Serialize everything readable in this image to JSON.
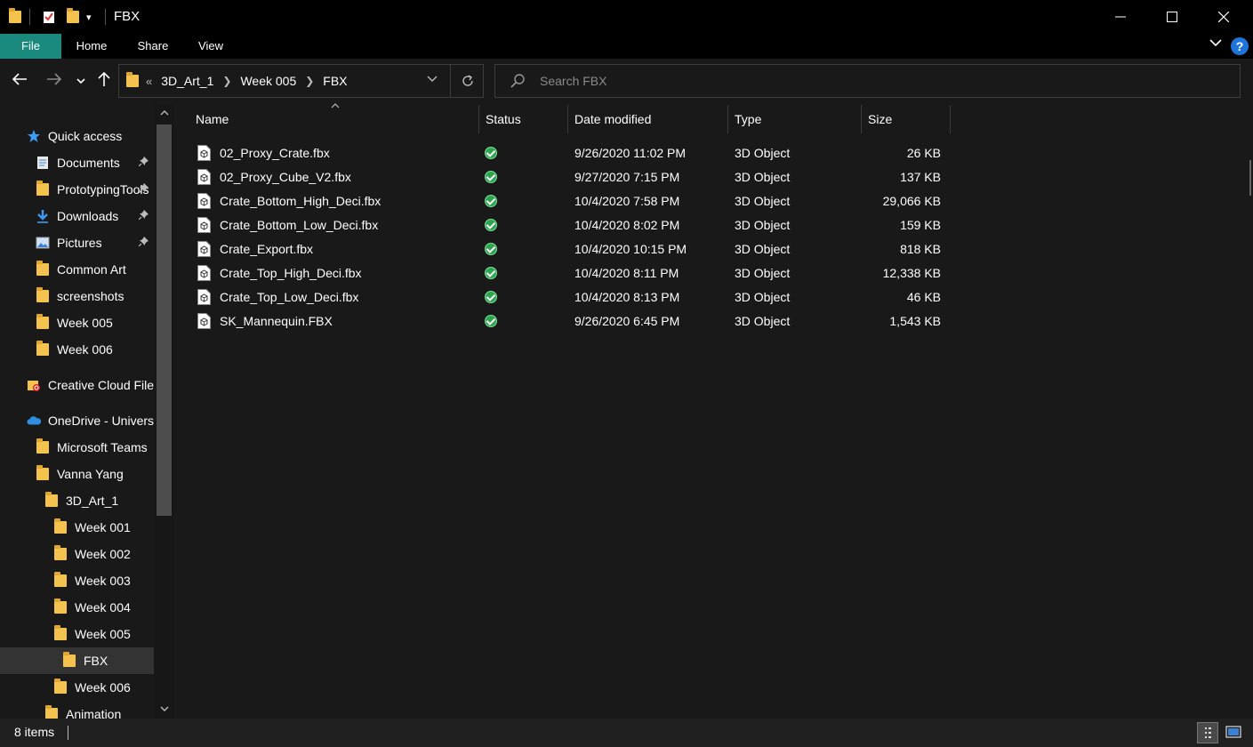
{
  "window": {
    "title": "FBX",
    "minimize": "—",
    "maximize": "☐",
    "close": "✕"
  },
  "ribbon": {
    "tabs": [
      "File",
      "Home",
      "Share",
      "View"
    ],
    "help": "?"
  },
  "address": {
    "overflow": "«",
    "crumbs": [
      "3D_Art_1",
      "Week 005",
      "FBX"
    ]
  },
  "search": {
    "placeholder": "Search FBX"
  },
  "sidebar": {
    "items": [
      {
        "label": "Quick access",
        "icon": "star-icon",
        "pinned": false
      },
      {
        "label": "Documents",
        "icon": "documents-icon",
        "pinned": true
      },
      {
        "label": "PrototypingTools",
        "icon": "folder-icon",
        "pinned": true
      },
      {
        "label": "Downloads",
        "icon": "download-icon",
        "pinned": true
      },
      {
        "label": "Pictures",
        "icon": "pictures-icon",
        "pinned": true
      },
      {
        "label": "Common Art",
        "icon": "folder-icon",
        "pinned": false
      },
      {
        "label": "screenshots",
        "icon": "folder-icon",
        "pinned": false
      },
      {
        "label": "Week 005",
        "icon": "folder-icon",
        "pinned": false
      },
      {
        "label": "Week 006",
        "icon": "folder-icon",
        "pinned": false
      },
      {
        "label": "Creative Cloud Files",
        "icon": "creative-cloud-icon",
        "pinned": false
      },
      {
        "label": "OneDrive - University",
        "icon": "onedrive-icon",
        "pinned": false
      },
      {
        "label": "Microsoft Teams",
        "icon": "folder-icon",
        "pinned": false
      },
      {
        "label": "Vanna Yang",
        "icon": "folder-icon",
        "pinned": false
      },
      {
        "label": "3D_Art_1",
        "icon": "folder-icon",
        "pinned": false
      },
      {
        "label": "Week 001",
        "icon": "folder-icon",
        "pinned": false
      },
      {
        "label": "Week 002",
        "icon": "folder-icon",
        "pinned": false
      },
      {
        "label": "Week 003",
        "icon": "folder-icon",
        "pinned": false
      },
      {
        "label": "Week 004",
        "icon": "folder-icon",
        "pinned": false
      },
      {
        "label": "Week 005",
        "icon": "folder-icon",
        "pinned": false
      },
      {
        "label": "FBX",
        "icon": "folder-icon",
        "pinned": false,
        "selected": true
      },
      {
        "label": "Week 006",
        "icon": "folder-icon",
        "pinned": false
      },
      {
        "label": "Animation",
        "icon": "folder-icon",
        "pinned": false
      }
    ]
  },
  "columns": {
    "name": "Name",
    "status": "Status",
    "date": "Date modified",
    "type": "Type",
    "size": "Size"
  },
  "files": [
    {
      "name": "02_Proxy_Crate.fbx",
      "status": "synced",
      "date": "9/26/2020 11:02 PM",
      "type": "3D Object",
      "size": "26 KB"
    },
    {
      "name": "02_Proxy_Cube_V2.fbx",
      "status": "synced",
      "date": "9/27/2020 7:15 PM",
      "type": "3D Object",
      "size": "137 KB"
    },
    {
      "name": "Crate_Bottom_High_Deci.fbx",
      "status": "synced",
      "date": "10/4/2020 7:58 PM",
      "type": "3D Object",
      "size": "29,066 KB"
    },
    {
      "name": "Crate_Bottom_Low_Deci.fbx",
      "status": "synced",
      "date": "10/4/2020 8:02 PM",
      "type": "3D Object",
      "size": "159 KB"
    },
    {
      "name": "Crate_Export.fbx",
      "status": "synced",
      "date": "10/4/2020 10:15 PM",
      "type": "3D Object",
      "size": "818 KB"
    },
    {
      "name": "Crate_Top_High_Deci.fbx",
      "status": "synced",
      "date": "10/4/2020 8:11 PM",
      "type": "3D Object",
      "size": "12,338 KB"
    },
    {
      "name": "Crate_Top_Low_Deci.fbx",
      "status": "synced",
      "date": "10/4/2020 8:13 PM",
      "type": "3D Object",
      "size": "46 KB"
    },
    {
      "name": "SK_Mannequin.FBX",
      "status": "synced",
      "date": "9/26/2020 6:45 PM",
      "type": "3D Object",
      "size": "1,543 KB"
    }
  ],
  "statusbar": {
    "count": "8 items"
  },
  "colors": {
    "accent": "#1a8a7f",
    "folder": "#f3c24f",
    "synced": "#2ea44f",
    "background": "#191919"
  }
}
